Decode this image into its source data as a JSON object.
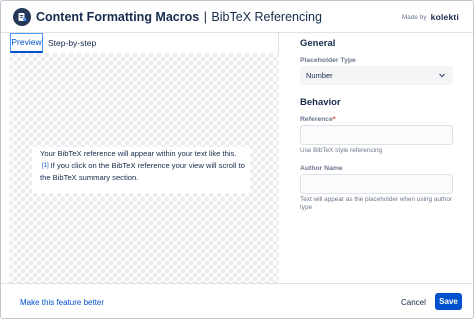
{
  "header": {
    "title_primary": "Content Formatting Macros",
    "title_separator": "|",
    "title_secondary": "BibTeX Referencing",
    "made_by_label": "Made by",
    "brand": "kolekti"
  },
  "tabs": [
    {
      "label": "Preview",
      "active": true
    },
    {
      "label": "Step-by-step",
      "active": false
    }
  ],
  "preview": {
    "text_before": "Your BibTeX reference will appear within your text like this.",
    "ref_marker": "[1]",
    "text_after": "If you click on the BibTeX reference your view will scroll to the BibTeX summary section."
  },
  "settings": {
    "general_heading": "General",
    "placeholder_type_label": "Placeholder Type",
    "placeholder_type_value": "Number",
    "behavior_heading": "Behavior",
    "reference_label": "Reference",
    "reference_required_mark": "*",
    "reference_value": "",
    "reference_help": "Use BibTeX style referencing",
    "author_label": "Author Name",
    "author_value": "",
    "author_help": "Text will appear as the placeholder when using author type"
  },
  "footer": {
    "feedback_link": "Make this feature better",
    "cancel_label": "Cancel",
    "save_label": "Save"
  },
  "colors": {
    "accent": "#0052cc",
    "required": "#de350b"
  }
}
